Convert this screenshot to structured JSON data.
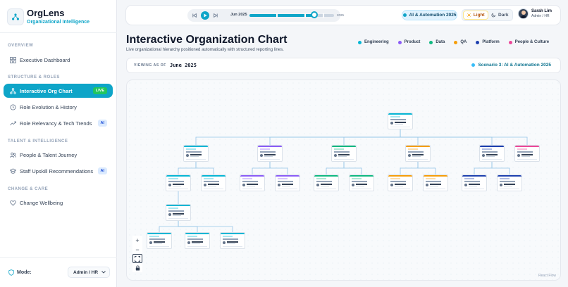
{
  "app": {
    "name": "OrgLens",
    "subtitle": "Organizational Intelligence"
  },
  "sidebar": {
    "sections": [
      {
        "title": "OVERVIEW"
      },
      {
        "title": "STRUCTURE & ROLES"
      },
      {
        "title": "TALENT & INTELLIGENCE"
      },
      {
        "title": "CHANGE & CARE"
      }
    ],
    "items": [
      {
        "label": "Executive Dashboard",
        "icon": "dashboard-icon"
      },
      {
        "label": "Interactive Org Chart",
        "icon": "org-chart-icon",
        "badge": "LIVE",
        "active": true
      },
      {
        "label": "Role Evolution & History",
        "icon": "history-icon"
      },
      {
        "label": "Role Relevancy & Tech Trends",
        "icon": "trend-icon",
        "badge": "AI"
      },
      {
        "label": "People & Talent Journey",
        "icon": "people-icon"
      },
      {
        "label": "Staff Upskill Recommendations",
        "icon": "upskill-icon",
        "badge": "AI"
      },
      {
        "label": "Change Wellbeing",
        "icon": "heart-icon"
      }
    ],
    "mode": {
      "label": "Mode:",
      "value": "Admin / HR"
    }
  },
  "topbar": {
    "timeline": {
      "start": "Jun 2025",
      "end": "2025",
      "progress": 0.77
    },
    "scenario": "AI & Automation 2025",
    "theme": {
      "light": "Light",
      "dark": "Dark",
      "selected": "light"
    },
    "user": {
      "name": "Sarah Lim",
      "role": "Admin / HR"
    }
  },
  "page": {
    "title": "Interactive Organization Chart",
    "subtitle": "Live organizational hierarchy positioned automatically with structured reporting lines.",
    "legend": [
      {
        "label": "Engineering",
        "color": "#06b6d4"
      },
      {
        "label": "Product",
        "color": "#8b5cf6"
      },
      {
        "label": "Data",
        "color": "#10b981"
      },
      {
        "label": "QA",
        "color": "#f59e0b"
      },
      {
        "label": "Platform",
        "color": "#1e40af"
      },
      {
        "label": "People & Culture",
        "color": "#ec4899"
      }
    ],
    "viewing": {
      "label": "VIEWING AS OF",
      "value": "June 2025",
      "scenario": "Scenario 3: AI & Automation 2025"
    }
  },
  "canvas": {
    "attribution": "React Flow",
    "controls": {
      "zoom_in": "+",
      "zoom_out": "−"
    }
  },
  "colors": {
    "accent": "#0ea5c8",
    "ai_badge": "#dbeafe",
    "live_badge": "#22c55e"
  }
}
